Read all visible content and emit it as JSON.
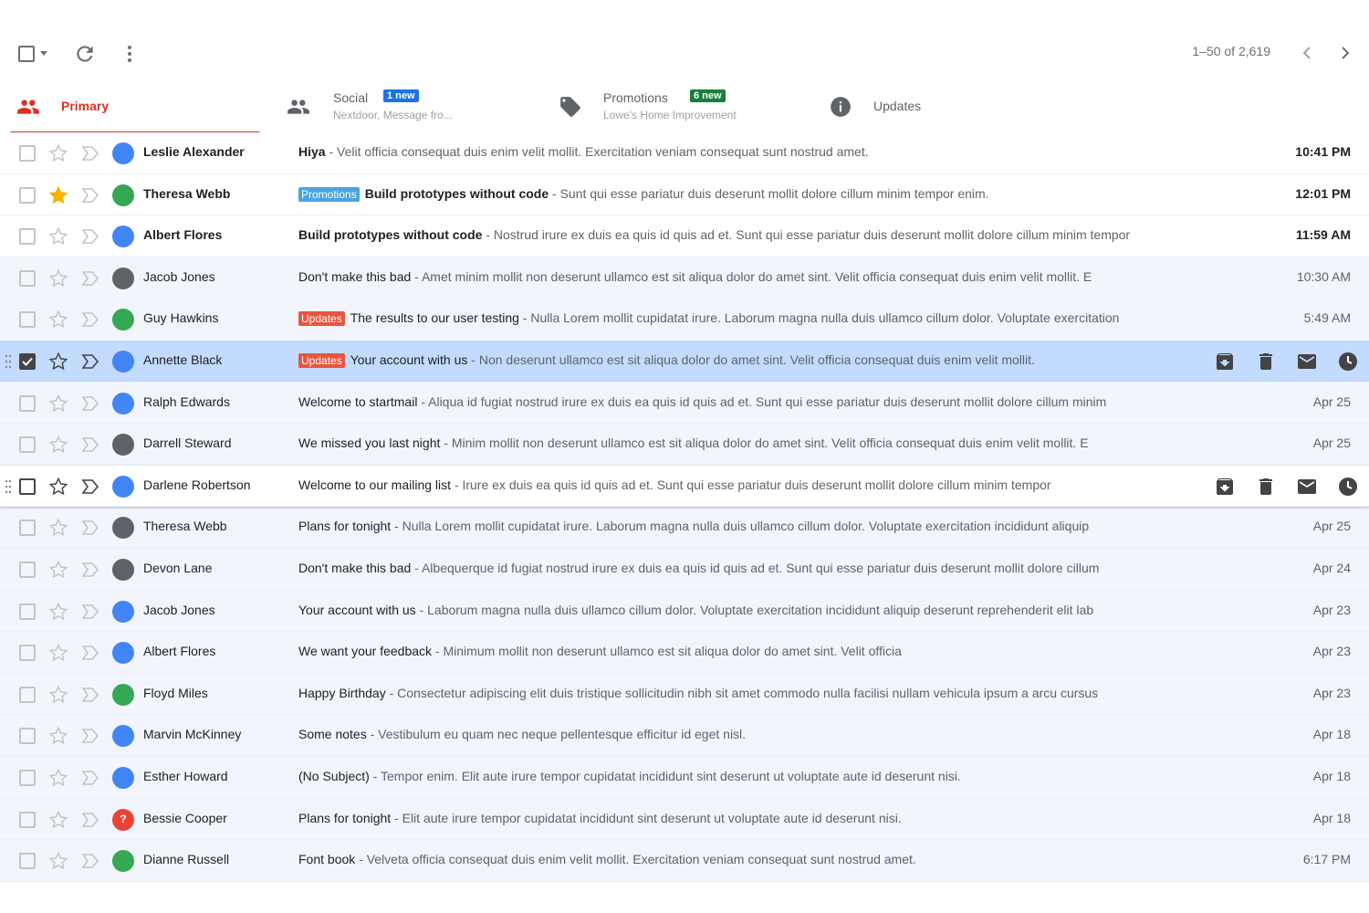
{
  "toolbar": {
    "pagination": "1–50 of 2,619",
    "icons": [
      "select-all-checkbox",
      "caret-down-icon",
      "refresh-icon",
      "more-vert-icon",
      "chevron-left-icon",
      "chevron-right-icon"
    ]
  },
  "tabs": [
    {
      "id": "primary",
      "label": "Primary",
      "sub": "",
      "badge": "",
      "icon": "people-icon"
    },
    {
      "id": "social",
      "label": "Social",
      "sub": "Nextdoor, Message fro...",
      "badge": "1 new",
      "badge_color": "#1a73e8",
      "icon": "group-icon"
    },
    {
      "id": "promotions",
      "label": "Promotions",
      "sub": "Lowe's Home Improvement",
      "badge": "6 new",
      "badge_color": "#188038",
      "icon": "tag-icon"
    },
    {
      "id": "updates",
      "label": "Updates",
      "sub": "",
      "badge": "",
      "icon": "info-icon"
    }
  ],
  "colors": {
    "accent": "#d93025",
    "star": "#f4b400",
    "avatar_blue": "#4285f4",
    "avatar_green": "#34a853",
    "avatar_gray": "#5f6368",
    "avatar_red": "#ea4335",
    "label_promotions": "#4aa3df",
    "label_updates": "#e8553e"
  },
  "emails": [
    {
      "sender": "Leslie Alexander",
      "avatar": "#4285f4",
      "label": "",
      "subject": "Hiya",
      "snippet": " - Velit officia consequat duis enim velit mollit. Exercitation veniam consequat sunt nostrud amet.",
      "date": "10:41 PM",
      "unread": true,
      "starred": false,
      "state": ""
    },
    {
      "sender": "Theresa Webb",
      "avatar": "#34a853",
      "label": "Promotions",
      "label_color": "#4aa3df",
      "subject": "Build prototypes without code",
      "snippet": " - Sunt qui esse pariatur duis deserunt mollit dolore cillum minim tempor enim.",
      "date": "12:01 PM",
      "unread": true,
      "starred": true,
      "state": ""
    },
    {
      "sender": "Albert Flores",
      "avatar": "#4285f4",
      "label": "",
      "subject": "Build prototypes without code",
      "snippet": " - Nostrud irure ex duis ea quis id quis ad et. Sunt qui esse pariatur duis deserunt mollit dolore cillum minim tempor",
      "date": "11:59 AM",
      "unread": true,
      "starred": false,
      "state": ""
    },
    {
      "sender": "Jacob Jones",
      "avatar": "#5f6368",
      "label": "",
      "subject": "Don't make this bad",
      "snippet": " - Amet minim mollit non deserunt ullamco est sit aliqua dolor do amet sint. Velit officia consequat duis enim velit mollit. E",
      "date": "10:30 AM",
      "unread": false,
      "starred": false,
      "state": ""
    },
    {
      "sender": "Guy Hawkins",
      "avatar": "#34a853",
      "label": "Updates",
      "label_color": "#e8553e",
      "subject": "The results to our user testing",
      "snippet": " - Nulla Lorem mollit cupidatat irure. Laborum magna nulla duis ullamco cillum dolor. Voluptate exercitation",
      "date": "5:49 AM",
      "unread": false,
      "starred": false,
      "state": ""
    },
    {
      "sender": "Annette Black",
      "avatar": "#4285f4",
      "label": "Updates",
      "label_color": "#e8553e",
      "subject": "Your account with us",
      "snippet": " - Non deserunt ullamco est sit aliqua dolor do amet sint. Velit officia consequat duis enim velit mollit.",
      "date": "",
      "unread": false,
      "starred": false,
      "state": "selected"
    },
    {
      "sender": "Ralph Edwards",
      "avatar": "#4285f4",
      "label": "",
      "subject": "Welcome to startmail",
      "snippet": " - Aliqua id fugiat nostrud irure ex duis ea quis id quis ad et. Sunt qui esse pariatur duis deserunt mollit dolore cillum minim",
      "date": "Apr 25",
      "unread": false,
      "starred": false,
      "state": ""
    },
    {
      "sender": "Darrell Steward",
      "avatar": "#5f6368",
      "label": "",
      "subject": "We missed you last night",
      "snippet": " - Minim mollit non deserunt ullamco est sit aliqua dolor do amet sint. Velit officia consequat duis enim velit mollit. E",
      "date": "Apr 25",
      "unread": false,
      "starred": false,
      "state": ""
    },
    {
      "sender": "Darlene Robertson",
      "avatar": "#4285f4",
      "label": "",
      "subject": "Welcome to our mailing list",
      "snippet": " - Irure ex duis ea quis id quis ad et. Sunt qui esse pariatur duis deserunt mollit dolore cillum minim tempor",
      "date": "",
      "unread": false,
      "starred": false,
      "state": "hovered"
    },
    {
      "sender": "Theresa Webb",
      "avatar": "#5f6368",
      "label": "",
      "subject": "Plans for tonight",
      "snippet": " - Nulla Lorem mollit cupidatat irure. Laborum magna nulla duis ullamco cillum dolor. Voluptate exercitation incididunt aliquip",
      "date": "Apr 25",
      "unread": false,
      "starred": false,
      "state": ""
    },
    {
      "sender": "Devon Lane",
      "avatar": "#5f6368",
      "label": "",
      "subject": "Don't make this bad",
      "snippet": " - Albequerque id fugiat nostrud irure ex duis ea quis id quis ad et. Sunt qui esse pariatur duis deserunt mollit dolore cillum",
      "date": "Apr 24",
      "unread": false,
      "starred": false,
      "state": ""
    },
    {
      "sender": "Jacob Jones",
      "avatar": "#4285f4",
      "label": "",
      "subject": "Your account with us",
      "snippet": " - Laborum magna nulla duis ullamco cillum dolor. Voluptate exercitation incididunt aliquip deserunt reprehenderit elit lab",
      "date": "Apr 23",
      "unread": false,
      "starred": false,
      "state": ""
    },
    {
      "sender": "Albert Flores",
      "avatar": "#4285f4",
      "label": "",
      "subject": "We want your feedback",
      "snippet": " - Minimum mollit non deserunt ullamco est sit aliqua dolor do amet sint. Velit officia",
      "date": "Apr 23",
      "unread": false,
      "starred": false,
      "state": ""
    },
    {
      "sender": "Floyd Miles",
      "avatar": "#34a853",
      "label": "",
      "subject": "Happy Birthday",
      "snippet": " - Consectetur adipiscing elit duis tristique sollicitudin nibh sit amet commodo nulla facilisi nullam vehicula ipsum a arcu cursus",
      "date": "Apr 23",
      "unread": false,
      "starred": false,
      "state": ""
    },
    {
      "sender": "Marvin McKinney",
      "avatar": "#4285f4",
      "label": "",
      "subject": "Some notes",
      "snippet": " - Vestibulum eu quam nec neque pellentesque efficitur id eget nisl.",
      "date": "Apr 18",
      "unread": false,
      "starred": false,
      "state": ""
    },
    {
      "sender": "Esther Howard",
      "avatar": "#4285f4",
      "label": "",
      "subject": "(No Subject)",
      "snippet": " - Tempor enim. Elit aute irure tempor cupidatat incididunt sint deserunt ut voluptate aute id deserunt nisi.",
      "date": "Apr 18",
      "unread": false,
      "starred": false,
      "state": ""
    },
    {
      "sender": "Bessie Cooper",
      "avatar": "#ea4335",
      "avatar_glyph": "?",
      "label": "",
      "subject": "Plans for tonight",
      "snippet": " - Elit aute irure tempor cupidatat incididunt sint deserunt ut voluptate aute id deserunt nisi.",
      "date": "Apr 18",
      "unread": false,
      "starred": false,
      "state": ""
    },
    {
      "sender": "Dianne Russell",
      "avatar": "#34a853",
      "label": "",
      "subject": "Font book",
      "snippet": " - Velveta officia consequat duis enim velit mollit. Exercitation veniam consequat sunt nostrud amet.",
      "date": "6:17 PM",
      "unread": false,
      "starred": false,
      "state": ""
    }
  ],
  "row_actions": [
    "archive-icon",
    "delete-icon",
    "mark-unread-icon",
    "snooze-icon"
  ]
}
